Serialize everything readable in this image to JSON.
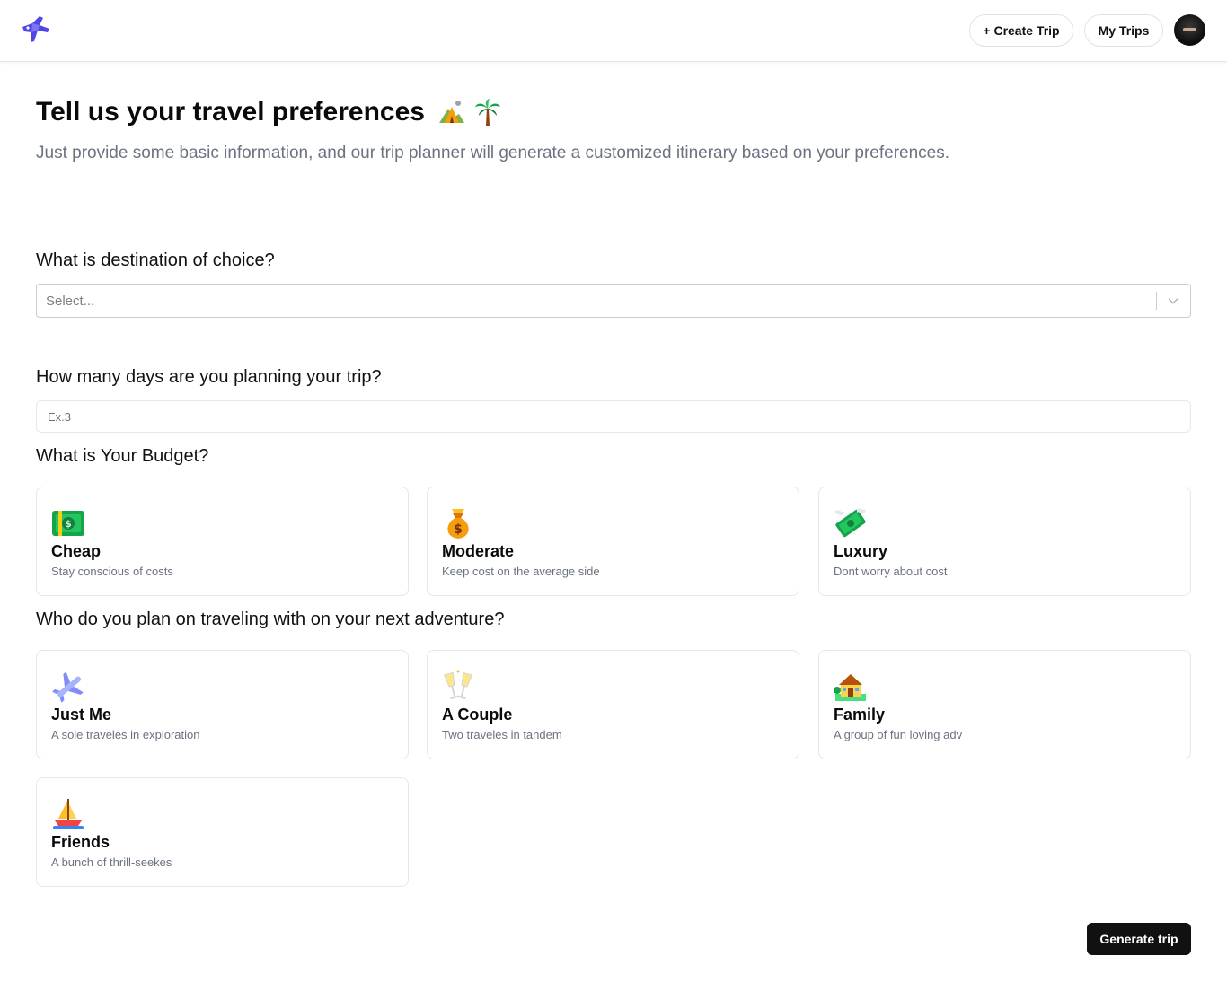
{
  "header": {
    "logo_icon": "plane-logo-icon",
    "create_trip_label": "+ Create Trip",
    "my_trips_label": "My Trips",
    "avatar_icon": "user-avatar"
  },
  "intro": {
    "title": "Tell us your travel preferences",
    "title_emojis": [
      "camping-icon",
      "palm-tree-icon"
    ],
    "subtitle": "Just provide some basic information, and our trip planner will generate a customized itinerary based on your preferences."
  },
  "destination": {
    "label": "What is destination of choice?",
    "placeholder": "Select...",
    "icon": "chevron-down-icon"
  },
  "days": {
    "label": "How many days are you planning your trip?",
    "placeholder": "Ex.3",
    "value": ""
  },
  "budget": {
    "label": "What is Your Budget?",
    "options": [
      {
        "title": "Cheap",
        "desc": "Stay conscious of costs",
        "icon": "dollar-bill-icon"
      },
      {
        "title": "Moderate",
        "desc": "Keep cost on the average side",
        "icon": "money-bag-icon"
      },
      {
        "title": "Luxury",
        "desc": "Dont worry about cost",
        "icon": "flying-money-icon"
      }
    ]
  },
  "travelers": {
    "label": "Who do you plan on traveling with on your next adventure?",
    "options": [
      {
        "title": "Just Me",
        "desc": "A sole traveles in exploration",
        "icon": "airplane-icon"
      },
      {
        "title": "A Couple",
        "desc": "Two traveles in tandem",
        "icon": "champagne-glasses-icon"
      },
      {
        "title": "Family",
        "desc": "A group of fun loving adv",
        "icon": "house-icon"
      },
      {
        "title": "Friends",
        "desc": "A bunch of thrill-seekes",
        "icon": "sailboat-icon"
      }
    ]
  },
  "generate_label": "Generate trip",
  "colors": {
    "primary_button": "#111111",
    "muted_text": "#6b7280",
    "border": "#e5e7eb",
    "logo": "#4f46e5"
  }
}
